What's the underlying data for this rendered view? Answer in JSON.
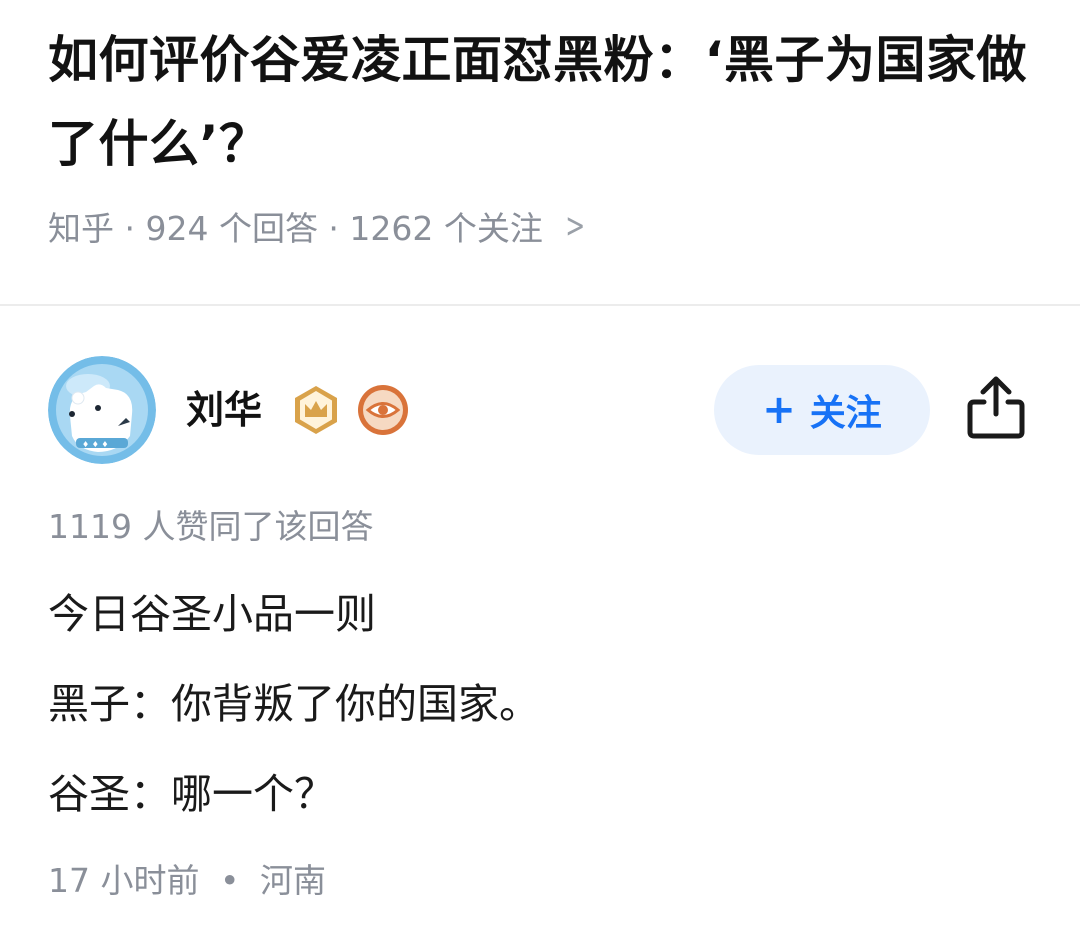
{
  "question": {
    "title": "如何评价谷爱凌正面怼黑粉：‘黑子为国家做了什么’？",
    "meta": "知乎 · 924 个回答 · 1262 个关注",
    "chevron_icon": "chevron-right-icon"
  },
  "author": {
    "name": "刘华",
    "avatar_icon": "polar-bear-avatar",
    "badges": [
      {
        "icon": "crown-badge-icon",
        "color": "#d9a24a"
      },
      {
        "icon": "eye-badge-icon",
        "color": "#d9733a"
      }
    ],
    "follow_label": "关注",
    "follow_plus": "+"
  },
  "share_icon": "share-icon",
  "answer": {
    "votes": "1119 人赞同了该回答",
    "paragraphs": [
      "今日谷圣小品一则",
      "黑子：你背叛了你的国家。",
      "谷圣：哪一个？"
    ],
    "time": "17 小时前",
    "separator": "•",
    "location": "河南"
  },
  "colors": {
    "accent": "#1772f6",
    "follow_bg": "#eaf2fd",
    "meta_text": "#8a8f99",
    "divider": "#ececec"
  }
}
